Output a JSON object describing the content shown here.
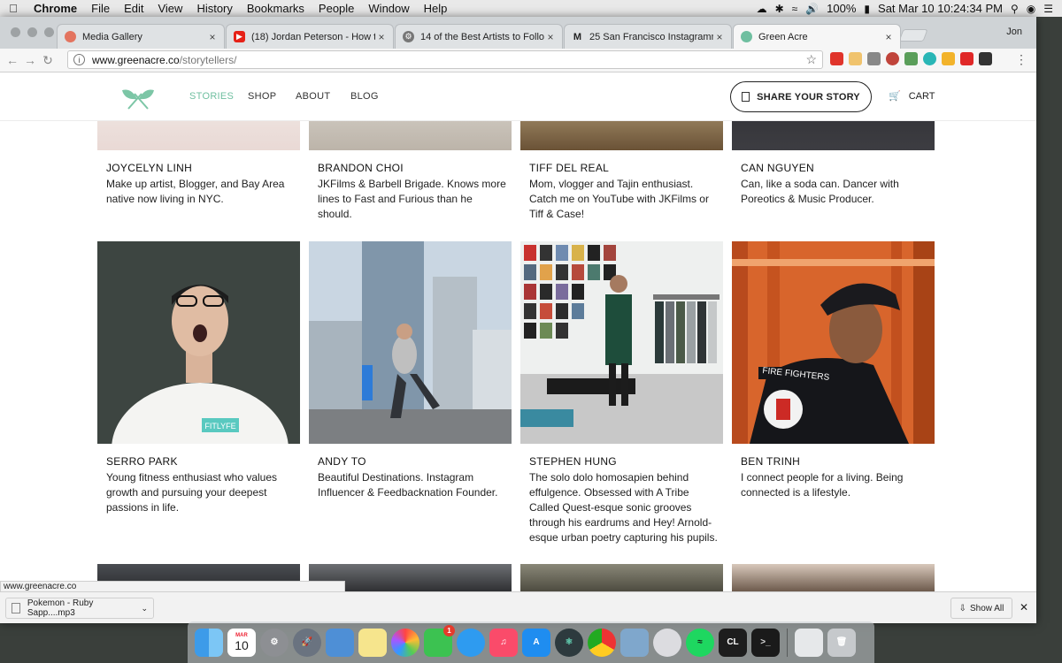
{
  "menubar": {
    "app": "Chrome",
    "items": [
      "File",
      "Edit",
      "View",
      "History",
      "Bookmarks",
      "People",
      "Window",
      "Help"
    ],
    "battery": "100%",
    "clock": "Sat Mar 10  10:24:34 PM"
  },
  "browser": {
    "tabs": [
      {
        "label": "Media Gallery",
        "color": "#e3745f"
      },
      {
        "label": "(18) Jordan Peterson - How to",
        "color": "#e62117"
      },
      {
        "label": "14 of the Best Artists to Follow",
        "color": "#777777"
      },
      {
        "label": "25 San Francisco Instagramme",
        "color": "#222222"
      },
      {
        "label": "Green Acre",
        "color": "#6fbfa0"
      }
    ],
    "profile": "Jon",
    "url_host": "www.greenacre.co",
    "url_path": "/storytellers/",
    "status_url": "www.greenacre.co"
  },
  "site": {
    "nav": [
      "STORIES",
      "SHOP",
      "ABOUT",
      "BLOG"
    ],
    "share_label": "SHARE YOUR STORY",
    "cart_label": "CART"
  },
  "stories": [
    {
      "name": "JOYCELYN LINH",
      "bio": "Make up artist, Blogger, and Bay Area native now living in NYC."
    },
    {
      "name": "BRANDON CHOI",
      "bio": "JKFilms & Barbell Brigade. Knows more lines to Fast and Furious than he should."
    },
    {
      "name": "TIFF DEL REAL",
      "bio": "Mom, vlogger and Tajin enthusiast. Catch me on YouTube with JKFilms or Tiff & Case!"
    },
    {
      "name": "CAN NGUYEN",
      "bio": "Can, like a soda can. Dancer with Poreotics & Music Producer."
    },
    {
      "name": "SERRO PARK",
      "bio": "Young fitness enthusiast who values growth and pursuing your deepest passions in life."
    },
    {
      "name": "ANDY TO",
      "bio": "Beautiful Destinations. Instagram Influencer & Feedbacknation Founder."
    },
    {
      "name": "STEPHEN HUNG",
      "bio": "The solo dolo homosapien behind effulgence. Obsessed with A Tribe Called Quest-esque sonic grooves through his eardrums and Hey! Arnold-esque urban poetry capturing his pupils."
    },
    {
      "name": "BEN TRINH",
      "bio": "I connect people for a living. Being connected is a lifestyle."
    }
  ],
  "photo_text": {
    "fitlyfe": "FITLYFE",
    "fire_fighters": "FIRE FIGHTERS"
  },
  "downloads": {
    "file": "Pokemon - Ruby Sapp....mp3",
    "show_all": "Show All"
  },
  "dock": {
    "calendar_month": "MAR",
    "calendar_day": "10",
    "facetime_badge": "1",
    "clion_label": "CL"
  }
}
